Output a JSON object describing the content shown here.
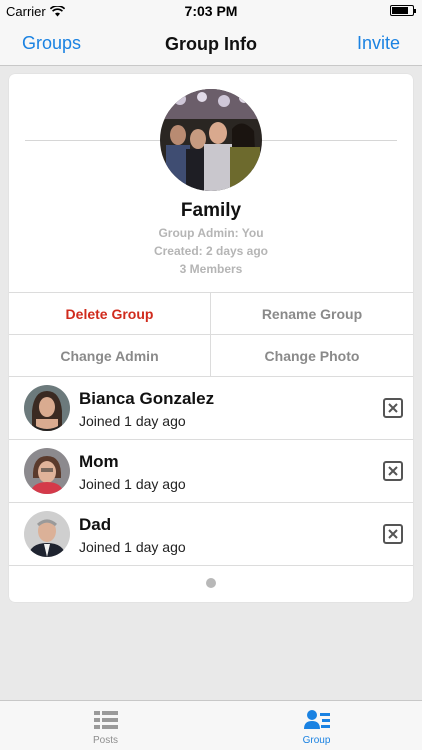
{
  "status_bar": {
    "carrier": "Carrier",
    "time": "7:03 PM"
  },
  "nav": {
    "back_label": "Groups",
    "title": "Group Info",
    "action_label": "Invite"
  },
  "group": {
    "name": "Family",
    "admin": "Group Admin: You",
    "created": "Created: 2 days ago",
    "member_count": "3 Members"
  },
  "actions": {
    "delete": "Delete Group",
    "rename": "Rename Group",
    "change_admin": "Change Admin",
    "change_photo": "Change Photo"
  },
  "members": [
    {
      "name": "Bianca Gonzalez",
      "joined": "Joined 1 day ago"
    },
    {
      "name": "Mom",
      "joined": "Joined 1 day ago"
    },
    {
      "name": "Dad",
      "joined": "Joined 1 day ago"
    }
  ],
  "tabs": [
    {
      "label": "Posts",
      "icon": "list-icon"
    },
    {
      "label": "Group",
      "icon": "group-icon"
    }
  ],
  "colors": {
    "accent": "#1a82e2",
    "danger": "#d02b1d",
    "muted": "#b5b5b5"
  }
}
